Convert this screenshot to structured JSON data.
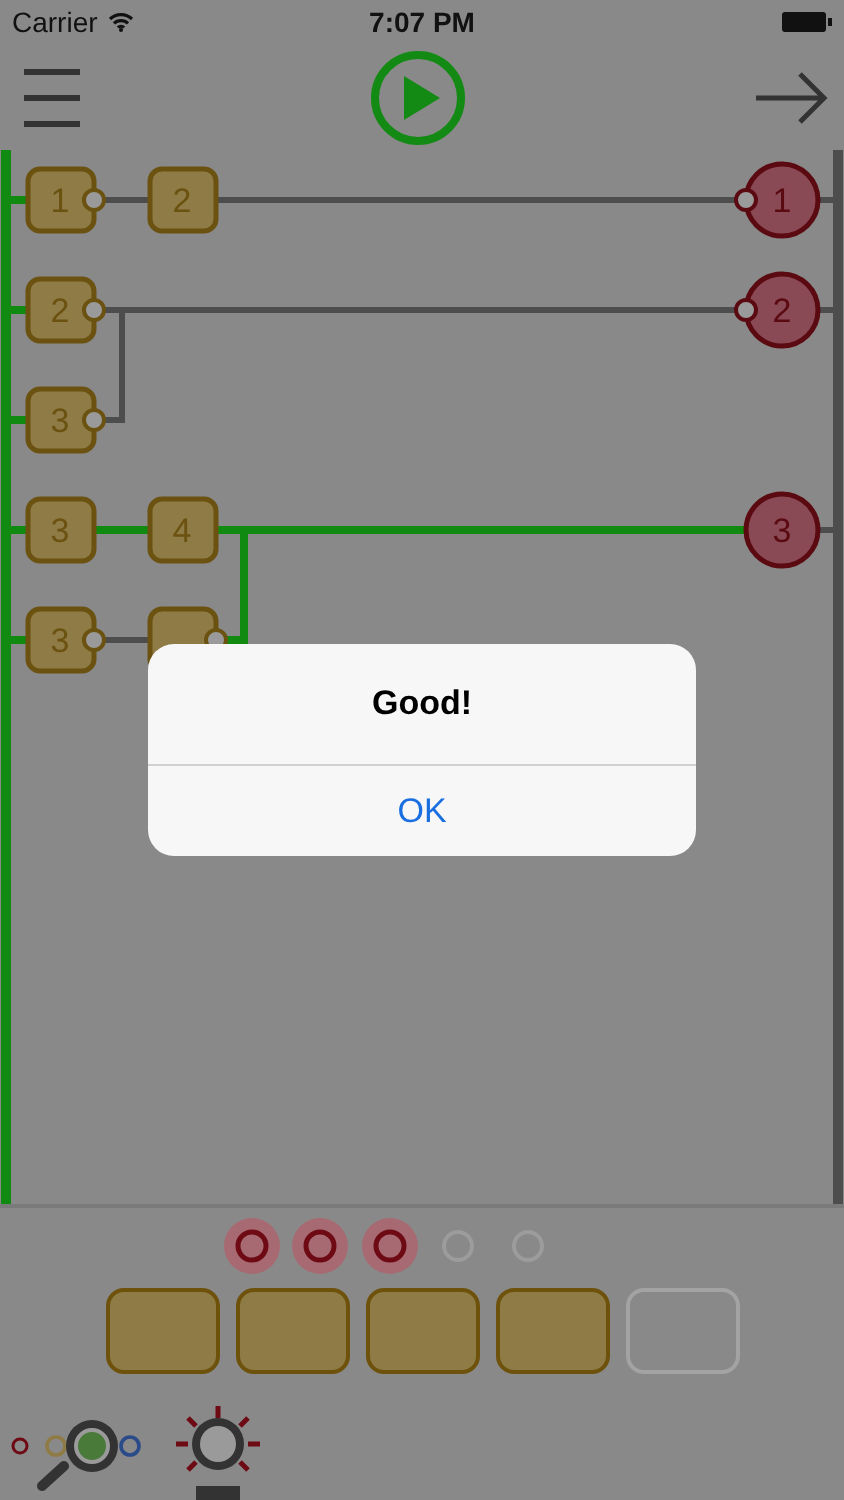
{
  "status_bar": {
    "carrier": "Carrier",
    "time": "7:07 PM"
  },
  "board": {
    "rail_powered": true,
    "gates": [
      {
        "label": "1",
        "connector": true
      },
      {
        "label": "2",
        "connector": false
      },
      {
        "label": "2",
        "connector": true
      },
      {
        "label": "3",
        "connector": true
      },
      {
        "label": "3",
        "connector": false
      },
      {
        "label": "4",
        "connector": false
      },
      {
        "label": "3",
        "connector": true
      },
      {
        "connector": true
      }
    ],
    "outputs": [
      {
        "label": "1",
        "connector": true
      },
      {
        "label": "2",
        "connector": true
      },
      {
        "label": "3",
        "connector": false
      }
    ],
    "wires": [
      {
        "powered": true
      },
      {
        "powered": true
      },
      {
        "powered": true
      },
      {
        "powered": true
      },
      {
        "powered": true
      },
      {
        "powered": false
      },
      {
        "powered": false
      },
      {
        "powered": false
      },
      {
        "powered": false
      },
      {
        "powered": false
      },
      {
        "powered": false
      },
      {
        "powered": true
      },
      {
        "powered": true
      },
      {
        "powered": true
      },
      {
        "powered": false
      },
      {
        "powered": false
      }
    ]
  },
  "indicators": [
    {
      "lit": true
    },
    {
      "lit": true
    },
    {
      "lit": true
    },
    {
      "lit": false
    },
    {
      "lit": false
    }
  ],
  "slots": [
    {
      "filled": true
    },
    {
      "filled": true
    },
    {
      "filled": true
    },
    {
      "filled": true
    },
    {
      "filled": false
    }
  ],
  "alert": {
    "title": "Good!",
    "button": "OK"
  }
}
